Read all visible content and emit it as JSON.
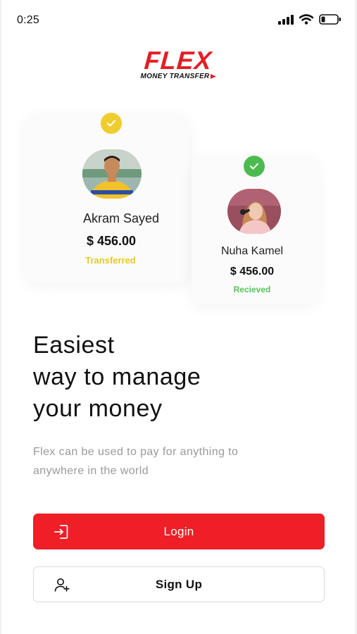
{
  "status_bar": {
    "time": "0:25",
    "icons": [
      "signal-icon",
      "wifi-icon",
      "battery-icon"
    ]
  },
  "brand": {
    "name": "FLEX",
    "tagline": "MONEY TRANSFER",
    "color": "#e41e26"
  },
  "transactions": [
    {
      "name": "Akram Sayed",
      "amount": "$ 456.00",
      "status": "Transferred",
      "status_color": "#e8c72c",
      "badge_color": "#efcd2f",
      "icon": "check-icon"
    },
    {
      "name": "Nuha Kamel",
      "amount": "$ 456.00",
      "status": "Recieved",
      "status_color": "#58c25a",
      "badge_color": "#4cbb4e",
      "icon": "check-icon"
    }
  ],
  "headline": {
    "line1": "Easiest",
    "line2": "way to manage",
    "line3": "your money"
  },
  "description": {
    "line1": "Flex can be used to pay for anything to",
    "line2": "anywhere in the world"
  },
  "actions": {
    "login_label": "Login",
    "login_icon": "login-icon",
    "signup_label": "Sign Up",
    "signup_icon": "add-user-icon",
    "accent": "#ee1f26"
  }
}
